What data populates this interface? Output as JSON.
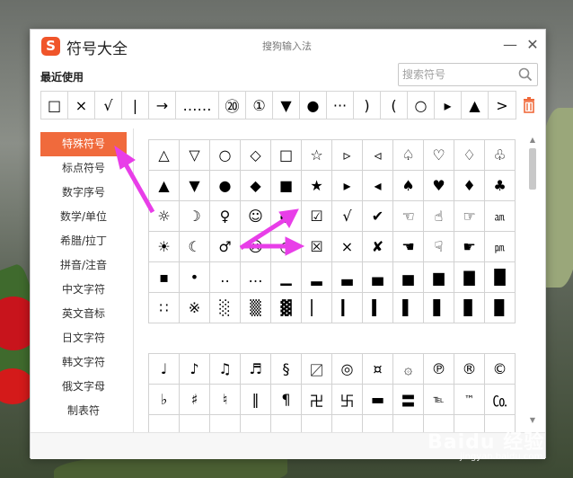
{
  "window": {
    "title": "符号大全",
    "subtitle": "搜狗输入法",
    "logo_letter": "S",
    "minimize_glyph": "—",
    "close_glyph": "✕"
  },
  "recent": {
    "label": "最近使用",
    "symbols": [
      "□",
      "×",
      "√",
      "|",
      "→",
      "……",
      "⑳",
      "①",
      "▼",
      "●",
      "···",
      ")",
      "(",
      "○",
      "▸",
      "▲",
      ">"
    ]
  },
  "search": {
    "placeholder": "搜索符号"
  },
  "sidebar": {
    "items": [
      {
        "label": "特殊符号",
        "active": true
      },
      {
        "label": "标点符号",
        "active": false
      },
      {
        "label": "数字序号",
        "active": false
      },
      {
        "label": "数学/单位",
        "active": false
      },
      {
        "label": "希腊/拉丁",
        "active": false
      },
      {
        "label": "拼音/注音",
        "active": false
      },
      {
        "label": "中文字符",
        "active": false
      },
      {
        "label": "英文音标",
        "active": false
      },
      {
        "label": "日文字符",
        "active": false
      },
      {
        "label": "韩文字符",
        "active": false
      },
      {
        "label": "俄文字母",
        "active": false
      },
      {
        "label": "制表符",
        "active": false
      }
    ]
  },
  "grid1": [
    [
      "△",
      "▽",
      "○",
      "◇",
      "□",
      "☆",
      "▹",
      "◃",
      "♤",
      "♡",
      "♢",
      "♧"
    ],
    [
      "▲",
      "▼",
      "●",
      "◆",
      "■",
      "★",
      "▸",
      "◂",
      "♠",
      "♥",
      "♦",
      "♣"
    ],
    [
      "☼",
      "☽",
      "♀",
      "☺",
      "◐",
      "☑",
      "√",
      "✔",
      "☜",
      "☝",
      "☞",
      "㏂"
    ],
    [
      "☀",
      "☾",
      "♂",
      "☹",
      "◑",
      "☒",
      "×",
      "✘",
      "☚",
      "☟",
      "☛",
      "㏘"
    ],
    [
      "▪",
      "•",
      "‥",
      "…",
      "▁",
      "▂",
      "▃",
      "▄",
      "▅",
      "▆",
      "▇",
      "█"
    ],
    [
      "∷",
      "※",
      "░",
      "▒",
      "▓",
      "▏",
      "▎",
      "▍",
      "▌",
      "▋",
      "▊",
      "▉"
    ]
  ],
  "grid2": [
    [
      "♩",
      "♪",
      "♫",
      "♬",
      "§",
      "〼",
      "◎",
      "¤",
      "۞",
      "℗",
      "®",
      "©"
    ],
    [
      "♭",
      "♯",
      "♮",
      "‖",
      "¶",
      "卍",
      "卐",
      "▬",
      "〓",
      "℡",
      "™",
      "㏇"
    ],
    [
      "",
      "",
      "",
      "",
      "",
      "",
      "",
      "",
      "",
      "",
      "",
      ""
    ]
  ],
  "watermark": {
    "text": "Baidu 经验",
    "sub": "jingyan.baidu.com"
  },
  "colors": {
    "accent": "#f06a3c",
    "arrow": "#e83ee8"
  }
}
